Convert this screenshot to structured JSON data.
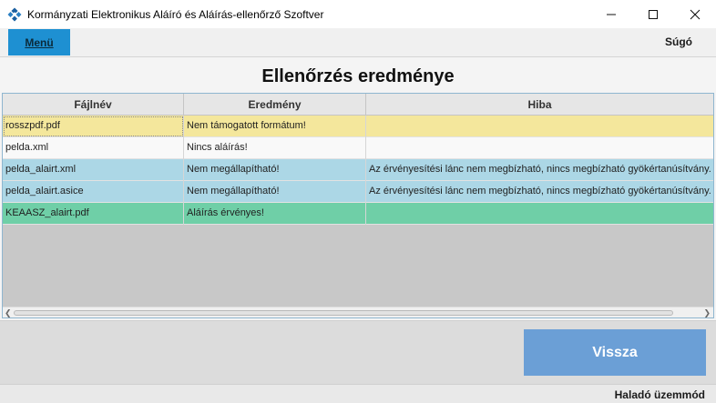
{
  "window": {
    "title": "Kormányzati Elektronikus Aláíró és Aláírás-ellenőrző Szoftver",
    "minimize": "—",
    "maximize": "☐",
    "close": "✕"
  },
  "menubar": {
    "menu_label": "Menü",
    "help_label": "Súgó"
  },
  "page": {
    "title": "Ellenőrzés eredménye"
  },
  "table": {
    "columns": [
      "Fájlnév",
      "Eredmény",
      "Hiba"
    ],
    "rows": [
      {
        "filename": "rosszpdf.pdf",
        "result": "Nem támogatott formátum!",
        "error": "",
        "status": "unsupported"
      },
      {
        "filename": "pelda.xml",
        "result": "Nincs aláírás!",
        "error": "",
        "status": "unsigned"
      },
      {
        "filename": "pelda_alairt.xml",
        "result": "Nem megállapítható!",
        "error": "Az érvényesítési lánc nem megbízható, nincs megbízható gyökértanúsítvány.",
        "status": "indeterminate"
      },
      {
        "filename": "pelda_alairt.asice",
        "result": "Nem megállapítható!",
        "error": "Az érvényesítési lánc nem megbízható, nincs megbízható gyökértanúsítvány.",
        "status": "indeterminate"
      },
      {
        "filename": "KEAASZ_alairt.pdf",
        "result": "Aláírás érvényes!",
        "error": "",
        "status": "valid"
      }
    ]
  },
  "actions": {
    "back_label": "Vissza"
  },
  "status": {
    "mode_label": "Haladó üzemmód"
  },
  "colors": {
    "accent": "#1e90d2",
    "row_unsupported": "#f4e79c",
    "row_unsigned": "#f9f9f9",
    "row_indeterminate": "#acd7e6",
    "row_valid": "#6fcfa7",
    "back_button": "#6b9fd6"
  },
  "icons": {
    "app": "app-logo-icon",
    "minimize": "minimize-icon",
    "maximize": "maximize-icon",
    "close": "close-icon"
  }
}
